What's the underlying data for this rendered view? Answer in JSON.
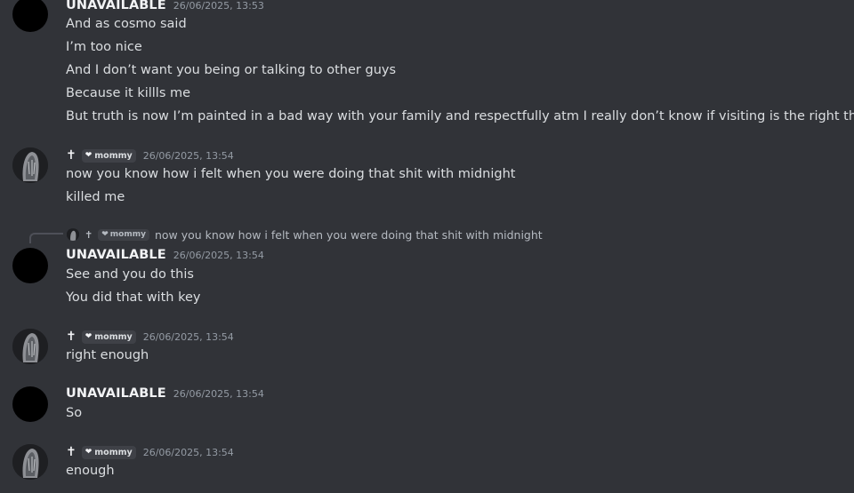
{
  "messages": [
    {
      "username": "UNAVAILABLE",
      "timestamp": "26/06/2025, 13:53",
      "lines": [
        "And as cosmo said",
        "I’m too nice",
        "And I don’t want you being or talking to other guys",
        "Because it killls me",
        "But truth is now I’m painted in a bad way with your family and respectfully atm I really don’t know if visiting is the right thing"
      ]
    },
    {
      "username": "✝",
      "tag": "mommy",
      "timestamp": "26/06/2025, 13:54",
      "lines": [
        "now you know how i felt when you were doing that shit with midnight",
        "killed me"
      ]
    },
    {
      "reply": {
        "username": "✝",
        "tag": "mommy",
        "text": "now you know how i felt when you were doing that shit with midnight"
      },
      "username": "UNAVAILABLE",
      "timestamp": "26/06/2025, 13:54",
      "lines": [
        "See and you do this",
        "You did that with key"
      ]
    },
    {
      "username": "✝",
      "tag": "mommy",
      "timestamp": "26/06/2025, 13:54",
      "lines": [
        "right enough"
      ]
    },
    {
      "username": "UNAVAILABLE",
      "timestamp": "26/06/2025, 13:54",
      "lines": [
        "So"
      ]
    },
    {
      "username": "✝",
      "tag": "mommy",
      "timestamp": "26/06/2025, 13:54",
      "lines": [
        "enough"
      ]
    }
  ]
}
